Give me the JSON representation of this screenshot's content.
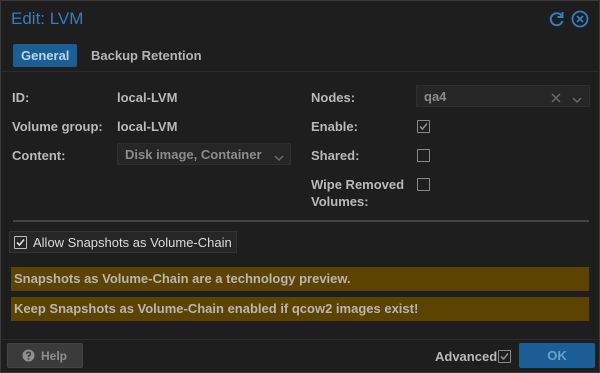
{
  "window": {
    "title": "Edit: LVM"
  },
  "tabs": [
    {
      "label": "General",
      "active": true
    },
    {
      "label": "Backup Retention",
      "active": false
    }
  ],
  "form": {
    "id_label": "ID:",
    "id_value": "local-LVM",
    "vg_label": "Volume group:",
    "vg_value": "local-LVM",
    "content_label": "Content:",
    "content_value": "Disk image, Container",
    "nodes_label": "Nodes:",
    "nodes_value": "qa4",
    "enable_label": "Enable:",
    "enable_checked": true,
    "shared_label": "Shared:",
    "shared_checked": false,
    "wipe_label_line1": "Wipe Removed",
    "wipe_label_line2": "Volumes:",
    "wipe_checked": false
  },
  "snapshot_option": {
    "label": "Allow Snapshots as Volume-Chain",
    "checked": true
  },
  "warnings": [
    "Snapshots as Volume-Chain are a technology preview.",
    "Keep Snapshots as Volume-Chain enabled if qcow2 images exist!"
  ],
  "footer": {
    "help_label": "Help",
    "advanced_label": "Advanced",
    "advanced_checked": true,
    "ok_label": "OK"
  },
  "colors": {
    "accent": "#2d7fc7",
    "warning_bg": "#5c4300",
    "background": "#1e1e1e"
  }
}
